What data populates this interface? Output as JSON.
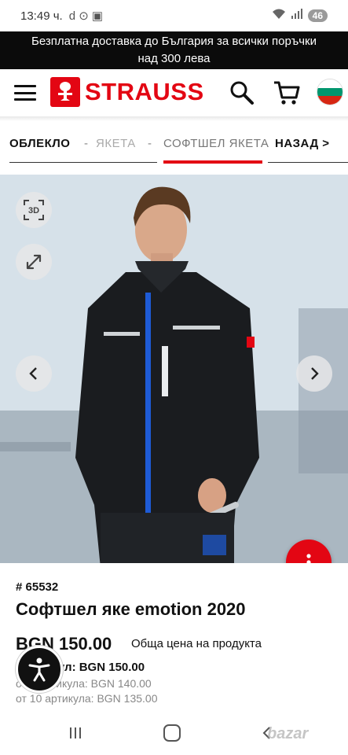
{
  "status": {
    "time": "13:49 ч.",
    "battery": "46"
  },
  "promo": {
    "line1": "Безплатна доставка до България за всички поръчки",
    "line2": "над 300 лева"
  },
  "header": {
    "logo_text": "STRAUSS",
    "brand_color": "#e30613",
    "flag": [
      "#ffffff",
      "#00966e",
      "#d62612"
    ]
  },
  "breadcrumb": {
    "root": "ОБЛЕКЛО",
    "sep": "-",
    "jackets": "ЯКЕТА",
    "current": "СОФТШЕЛ ЯКЕТА",
    "back": "НАЗАД >"
  },
  "gallery": {
    "btn_3d": "3D",
    "prev_icon": "chevron-left-icon",
    "next_icon": "chevron-right-icon"
  },
  "product": {
    "sku": "# 65532",
    "title": "Софтшел яке emotion 2020",
    "price": "BGN 150.00",
    "price_note": "Обща цена на продукта",
    "tier1": "1 артикул: BGN 150.00",
    "tier2": "от 5 артикула: BGN 140.00",
    "tier3": "от 10 артикула: BGN 135.00"
  },
  "watermark": "bazar"
}
